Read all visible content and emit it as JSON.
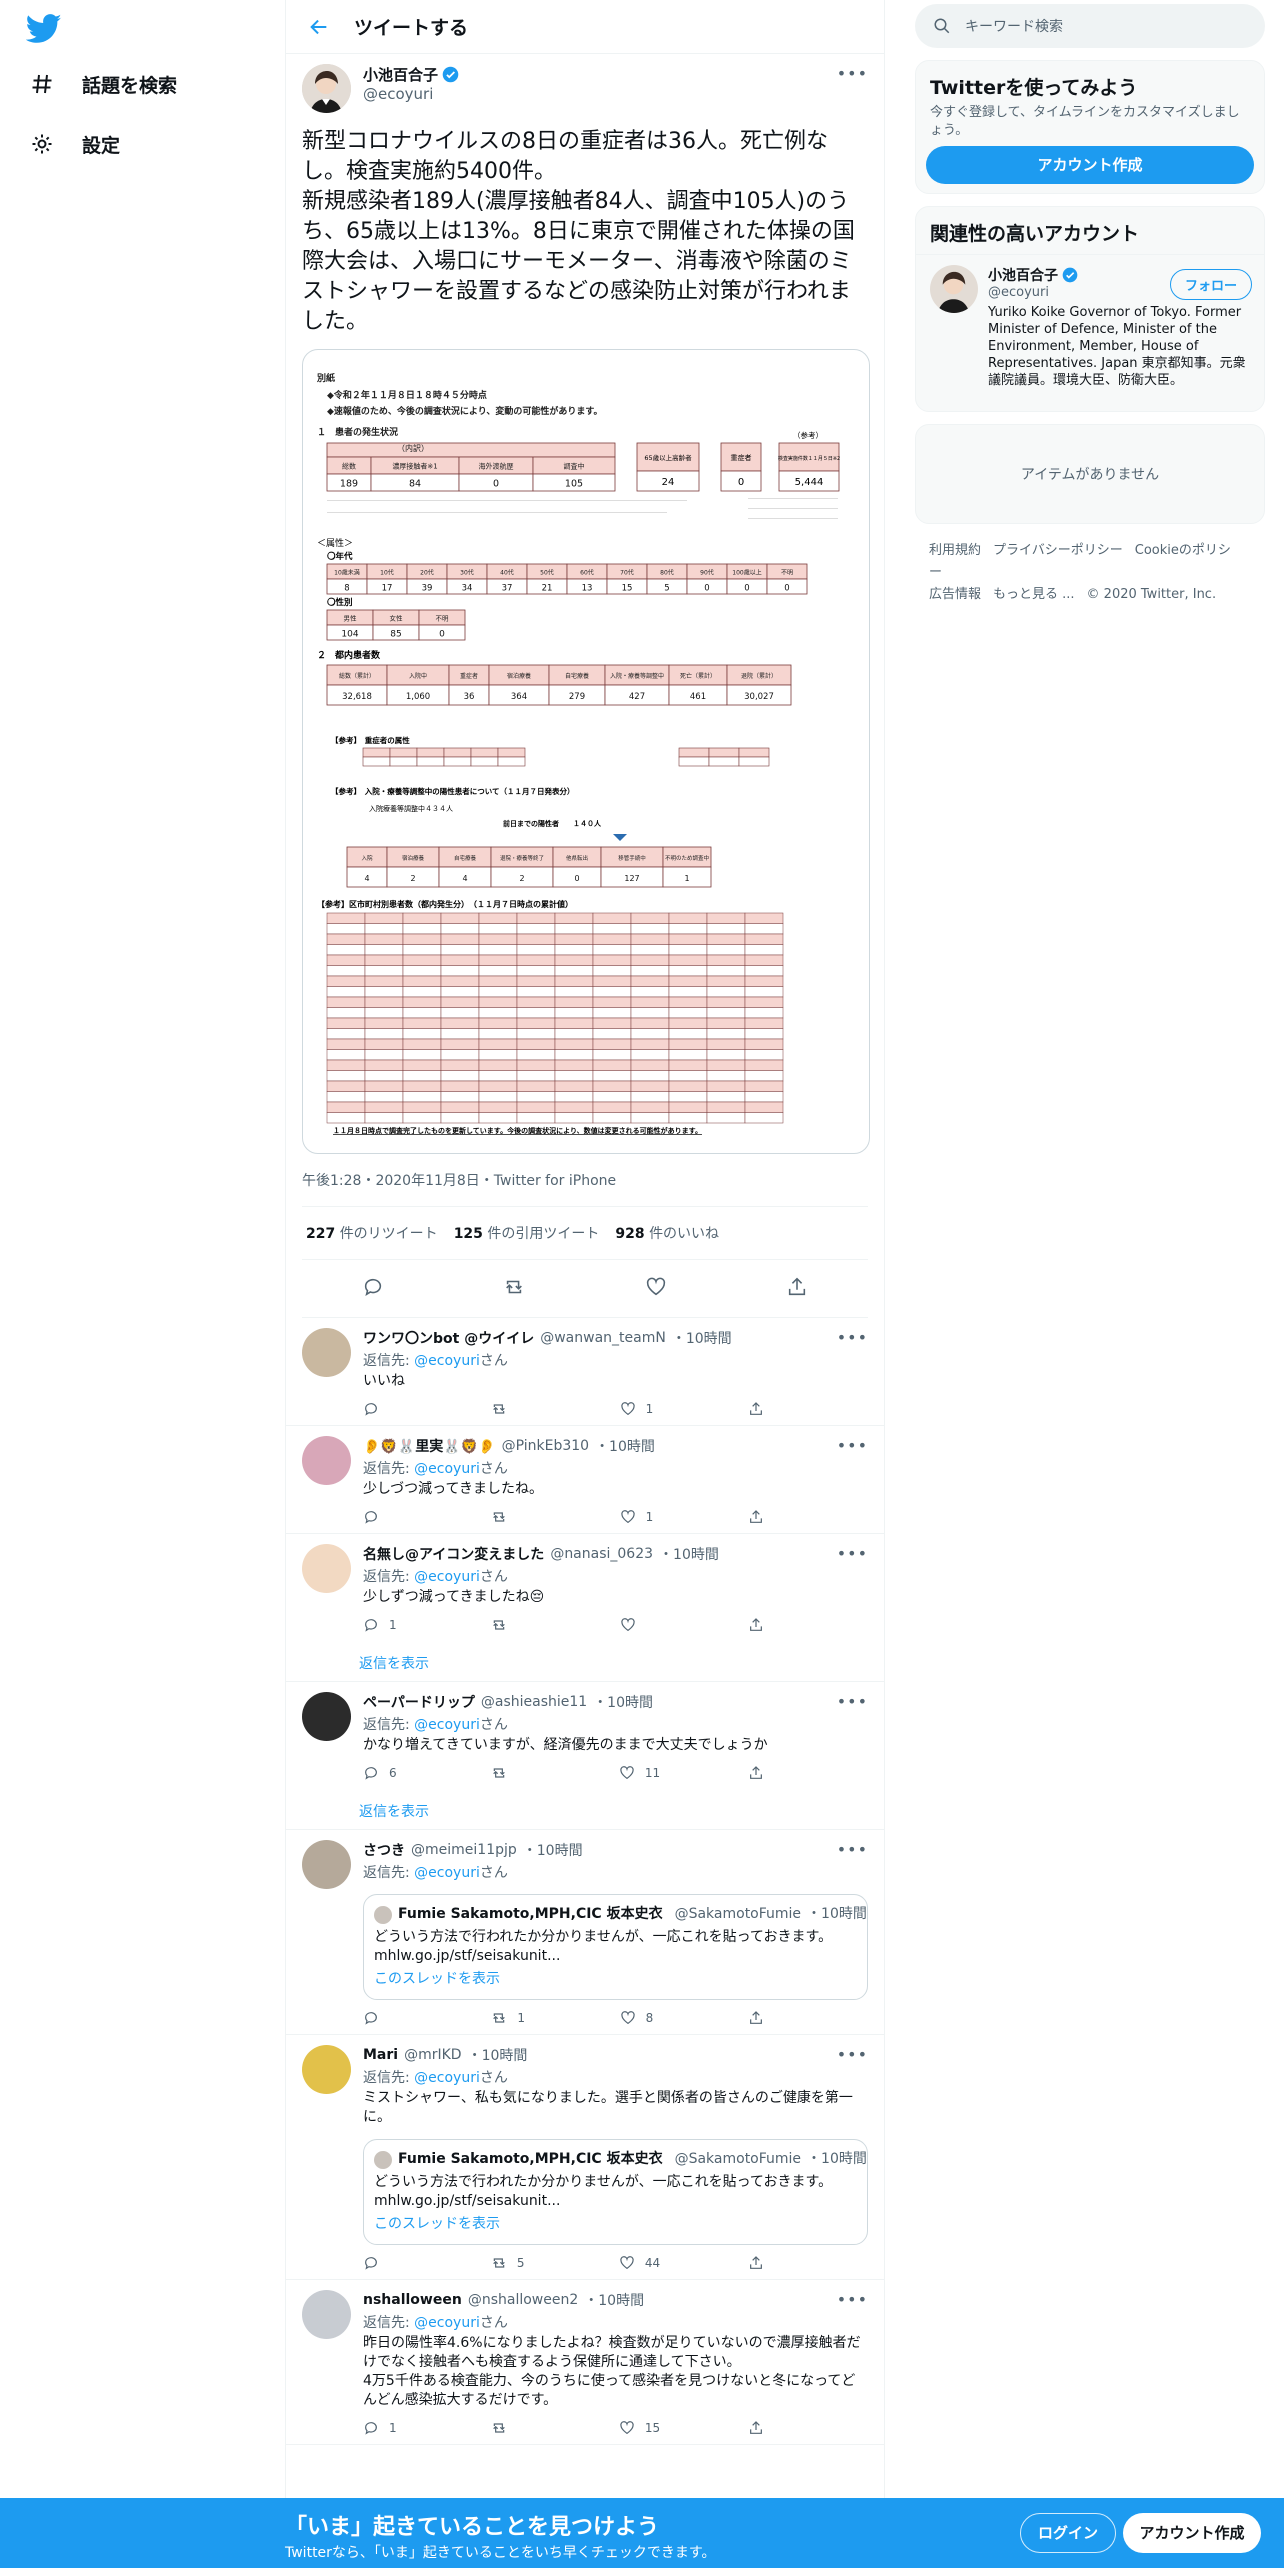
{
  "nav": {
    "items": [
      {
        "label": "話題を検索",
        "icon": "hash-icon"
      },
      {
        "label": "設定",
        "icon": "gear-icon"
      }
    ]
  },
  "header": {
    "title": "ツイートする"
  },
  "main_tweet": {
    "name": "小池百合子",
    "handle": "@ecoyuri",
    "text": "新型コロナウイルスの8日の重症者は36人。死亡例なし。検査実施約5400件。\n新規感染者189人(濃厚接触者84人、調査中105人)のうち、65歳以上は13%。8日に東京で開催された体操の国際大会は、入場口にサーモメーター、消毒液や除菌のミストシャワーを設置するなどの感染防止対策が行われました。",
    "time": "午後1:28・2020年11月8日・Twitter for iPhone",
    "retweets": "227",
    "retweets_label": "件のリツイート",
    "quotes": "125",
    "quotes_label": "件の引用ツイート",
    "likes": "928",
    "likes_label": "件のいいね"
  },
  "doc": {
    "l1": "別紙",
    "l2": "◆令和２年１１月８日１８時４５分時点",
    "l3": "◆速報値のため、今後の調査状況により、変動の可能性があります。",
    "s1": "１　患者の発生状況",
    "s1_cols": [
      "総数",
      "濃厚接触者※1",
      "海外渡航歴",
      "調査中"
    ],
    "s1_vals": [
      "189",
      "84",
      "0",
      "105"
    ],
    "s1_sub": "（内訳）",
    "elderly_label": "65歳以上高齢者",
    "elderly_val": "24",
    "severe_label": "重症者",
    "severe_val": "0",
    "tests_ref": "（参考）",
    "tests_label": "検査実施件数１１月５日※2",
    "tests_val": "5,444",
    "age_title": "＜属性＞",
    "age_sub": "〇年代",
    "age_cols": [
      "10歳未満",
      "10代",
      "20代",
      "30代",
      "40代",
      "50代",
      "60代",
      "70代",
      "80代",
      "90代",
      "100歳以上",
      "不明"
    ],
    "age_vals": [
      "8",
      "17",
      "39",
      "34",
      "37",
      "21",
      "13",
      "15",
      "5",
      "0",
      "0",
      "0"
    ],
    "sex_sub": "〇性別",
    "sex_cols": [
      "男性",
      "女性",
      "不明"
    ],
    "sex_vals": [
      "104",
      "85",
      "0"
    ],
    "s2": "２　都内患者数",
    "s2_cols": [
      "総数（累計）",
      "入院中",
      "重症者",
      "宿泊療養",
      "自宅療養",
      "入院・療養等調整中",
      "死亡（累計）",
      "退院（累計）"
    ],
    "s2_vals": [
      "32,618",
      "1,060",
      "36",
      "364",
      "279",
      "427",
      "461",
      "30,027"
    ],
    "ref1": "【参考】　重症者の属性",
    "ref2": "【参考】　入院・療養等調整中の陽性患者について（１１月７日発表分）",
    "ref2_a": "入院療養等調整中４３４人",
    "ref2_b": "前日までの陽性者　　１４０人",
    "s3_cols": [
      "入院",
      "宿泊療養",
      "自宅療養",
      "退院・療養等終了",
      "他県転出",
      "移管手続中",
      "不明のため調査中"
    ],
    "s3_vals": [
      "4",
      "2",
      "4",
      "2",
      "0",
      "127",
      "1"
    ],
    "ref3": "【参考】区市町村別患者数（都内発生分）　（１１月７日時点の累計値）",
    "foot": "１１月８日時点で調査完了したものを更新しています。今後の調査状況により、数値は変更される可能性があります。"
  },
  "replies": [
    {
      "name": "ワンワ〇ンbot @ウイイレ",
      "handle": "@wanwan_teamN",
      "time": "・10時間",
      "to": "返信先:",
      "to_handle": "@ecoyuri",
      "san": "さん",
      "text": "いいね",
      "reply_count": "",
      "rt_count": "",
      "like_count": "1"
    },
    {
      "name": "👂🦁🐰里実🐰🦁👂",
      "handle": "@PinkEb310",
      "time": "・10時間",
      "to": "返信先:",
      "to_handle": "@ecoyuri",
      "san": "さん",
      "text": "少しづつ減ってきましたね。",
      "reply_count": "",
      "rt_count": "",
      "like_count": "1"
    },
    {
      "name": "名無し@アイコン変えました",
      "handle": "@nanasi_0623",
      "time": "・10時間",
      "to": "返信先:",
      "to_handle": "@ecoyuri",
      "san": "さん",
      "text": "少しずつ減ってきましたね😔",
      "reply_count": "1",
      "rt_count": "",
      "like_count": "",
      "show_more": "返信を表示"
    },
    {
      "name": "ペーパードリップ",
      "handle": "@ashieashie11",
      "time": "・10時間",
      "to": "返信先:",
      "to_handle": "@ecoyuri",
      "san": "さん",
      "text": "かなり増えてきていますが、経済優先のままで大丈夫でしょうか",
      "reply_count": "6",
      "rt_count": "",
      "like_count": "11",
      "show_more": "返信を表示"
    },
    {
      "name": "さつき",
      "handle": "@meimei11pjp",
      "time": "・10時間",
      "to": "返信先:",
      "to_handle": "@ecoyuri",
      "san": "さん",
      "text": "",
      "reply_count": "",
      "rt_count": "1",
      "like_count": "8",
      "quote": {
        "name": "Fumie Sakamoto,MPH,CIC 坂本史衣",
        "handle": "@SakamotoFumie",
        "time": "・10時間",
        "text": "どういう方法で行われたか分かりませんが、一応これを貼っておきます。\nmhlw.go.jp/stf/seisakunit...",
        "thread": "このスレッドを表示"
      }
    },
    {
      "name": "Mari",
      "handle": "@mrIKD",
      "time": "・10時間",
      "to": "返信先:",
      "to_handle": "@ecoyuri",
      "san": "さん",
      "text": "ミストシャワー、私も気になりました。選手と関係者の皆さんのご健康を第一に。",
      "reply_count": "",
      "rt_count": "5",
      "like_count": "44",
      "quote": {
        "name": "Fumie Sakamoto,MPH,CIC 坂本史衣",
        "handle": "@SakamotoFumie",
        "time": "・10時間",
        "text": "どういう方法で行われたか分かりませんが、一応これを貼っておきます。\nmhlw.go.jp/stf/seisakunit...",
        "thread": "このスレッドを表示"
      }
    },
    {
      "name": "nshalloween",
      "handle": "@nshalloween2",
      "time": "・10時間",
      "to": "返信先:",
      "to_handle": "@ecoyuri",
      "san": "さん",
      "text": "昨日の陽性率4.6%になりましたよね？検査数が足りていないので濃厚接触者だけでなく接触者へも検査するよう保健所に通達して下さい。\n4万5千件ある検査能力、今のうちに使って感染者を見つけないと冬になってどんどん感染拡大するだけです。",
      "reply_count": "1",
      "rt_count": "",
      "like_count": "15"
    }
  ],
  "right": {
    "search_placeholder": "キーワード検索",
    "signup_title": "Twitterを使ってみよう",
    "signup_desc": "今すぐ登録して、タイムラインをカスタマイズしましょう。",
    "signup_button": "アカウント作成",
    "related_title": "関連性の高いアカウント",
    "related_name": "小池百合子",
    "related_handle": "@ecoyuri",
    "follow": "フォロー",
    "related_bio": "Yuriko Koike Governor of Tokyo. Former Minister of Defence, Minister of the Environment, Member, House of Representatives. Japan 東京都知事。元衆議院議員。環境大臣、防衛大臣。",
    "empty": "アイテムがありません",
    "footer": [
      "利用規約",
      "プライバシーポリシー",
      "Cookieのポリシー",
      "広告情報",
      "もっと見る ...",
      "© 2020 Twitter, Inc."
    ]
  },
  "bottom": {
    "title": "「いま」起きていることを見つけよう",
    "sub": "Twitterなら、「いま」起きていることをいち早くチェックできます。",
    "login": "ログイン",
    "signup": "アカウント作成"
  },
  "colors": {
    "accent": "#1d9bf0",
    "doc_header": "#f4cccc"
  }
}
